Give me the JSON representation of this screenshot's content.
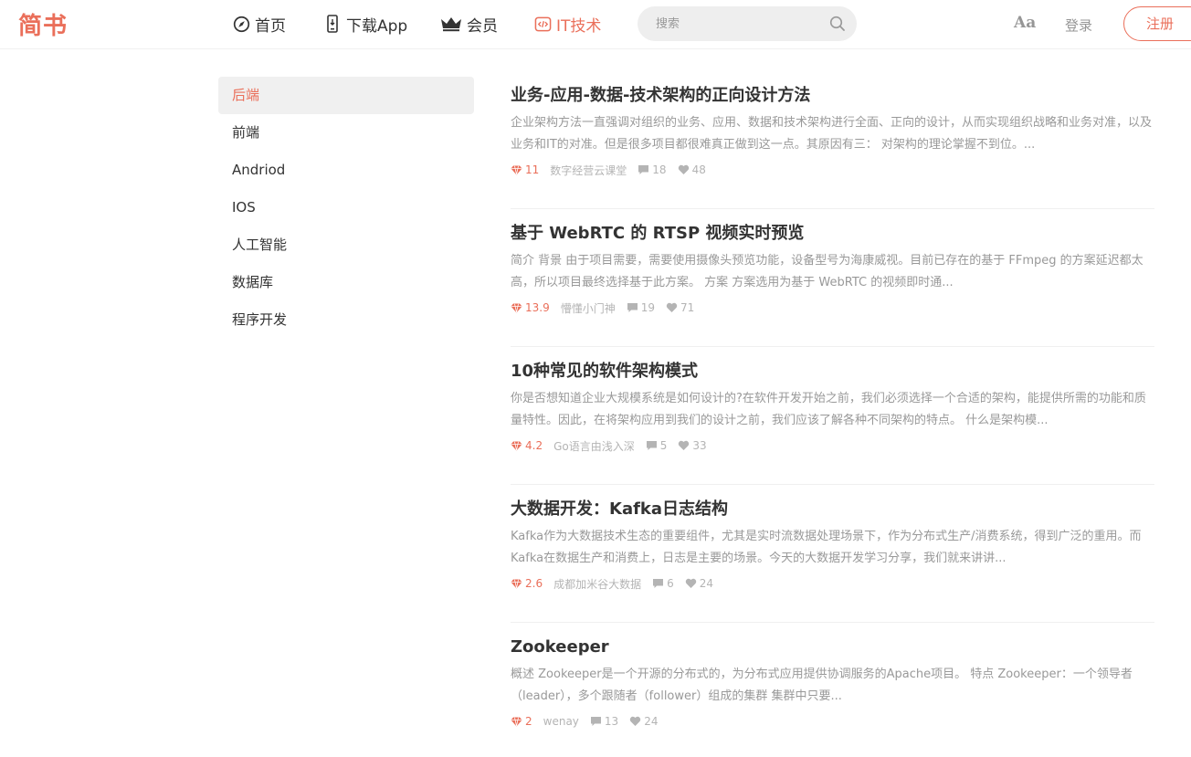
{
  "header": {
    "logo": "简书",
    "nav": [
      {
        "label": "首页",
        "icon": "compass-icon"
      },
      {
        "label": "下载App",
        "icon": "phone-icon"
      },
      {
        "label": "会员",
        "icon": "crown-icon"
      },
      {
        "label": "IT技术",
        "icon": "code-icon",
        "active": true
      }
    ],
    "search": {
      "placeholder": "搜索"
    },
    "font_toggle": "Aa",
    "login": "登录",
    "signup": "注册"
  },
  "sidebar": {
    "items": [
      {
        "label": "后端",
        "active": true
      },
      {
        "label": "前端"
      },
      {
        "label": "Andriod"
      },
      {
        "label": "IOS"
      },
      {
        "label": "人工智能"
      },
      {
        "label": "数据库"
      },
      {
        "label": "程序开发"
      }
    ]
  },
  "articles": [
    {
      "title": "业务-应用-数据-技术架构的正向设计方法",
      "abstract": "企业架构方法一直强调对组织的业务、应用、数据和技术架构进行全面、正向的设计，从而实现组织战略和业务对准，以及业务和IT的对准。但是很多项目都很难真正做到这一点。其原因有三： 对架构的理论掌握不到位。...",
      "diamonds": "11",
      "author": "数字经营云课堂",
      "comments": "18",
      "likes": "48"
    },
    {
      "title": "基于 WebRTC 的 RTSP 视频实时预览",
      "abstract": "简介 背景 由于项目需要，需要使用摄像头预览功能，设备型号为海康威视。目前已存在的基于 FFmpeg 的方案延迟都太高，所以项目最终选择基于此方案。 方案 方案选用为基于 WebRTC 的视频即时通...",
      "diamonds": "13.9",
      "author": "懵懂小门神",
      "comments": "19",
      "likes": "71"
    },
    {
      "title": "10种常见的软件架构模式",
      "abstract": "你是否想知道企业大规模系统是如何设计的?在软件开发开始之前，我们必须选择一个合适的架构，能提供所需的功能和质量特性。因此，在将架构应用到我们的设计之前，我们应该了解各种不同架构的特点。 什么是架构模...",
      "diamonds": "4.2",
      "author": "Go语言由浅入深",
      "comments": "5",
      "likes": "33"
    },
    {
      "title": "大数据开发：Kafka日志结构",
      "abstract": "Kafka作为大数据技术生态的重要组件，尤其是实时流数据处理场景下，作为分布式生产/消费系统，得到广泛的重用。而Kafka在数据生产和消费上，日志是主要的场景。今天的大数据开发学习分享，我们就来讲讲...",
      "diamonds": "2.6",
      "author": "成都加米谷大数据",
      "comments": "6",
      "likes": "24"
    },
    {
      "title": "Zookeeper",
      "abstract": "概述 Zookeeper是一个开源的分布式的，为分布式应用提供协调服务的Apache项目。 特点 Zookeeper：一个领导者（leader），多个跟随者（follower）组成的集群 集群中只要...",
      "diamonds": "2",
      "author": "wenay",
      "comments": "13",
      "likes": "24"
    }
  ],
  "colors": {
    "accent": "#ea6f5a",
    "muted": "#999999",
    "meta": "#b4b4b4"
  }
}
